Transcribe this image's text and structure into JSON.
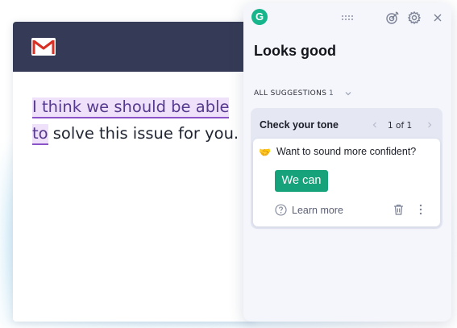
{
  "email": {
    "text_highlighted": "I think we should be able to",
    "text_rest": " solve this issue for you."
  },
  "panel": {
    "logo_letter": "G",
    "title": "Looks good",
    "suggestions_label": "ALL SUGGESTIONS",
    "suggestions_count": "1",
    "tone_card": {
      "title": "Check your tone",
      "pagination": "1 of 1",
      "question": "Want to sound more confident?",
      "replacement": "We can",
      "learn_more": "Learn more"
    }
  },
  "colors": {
    "accent": "#16a37c",
    "logo": "#16b58b",
    "header": "#353b56",
    "highlight_bg": "#f0e1fa",
    "highlight_underline": "#8a53c8"
  },
  "icons": [
    "gmail-icon",
    "grammarly-logo",
    "drag-handle-icon",
    "goals-icon",
    "settings-icon",
    "close-icon",
    "chevron-down-icon",
    "chevron-left-icon",
    "chevron-right-icon",
    "handshake-icon",
    "help-icon",
    "trash-icon",
    "more-icon"
  ]
}
